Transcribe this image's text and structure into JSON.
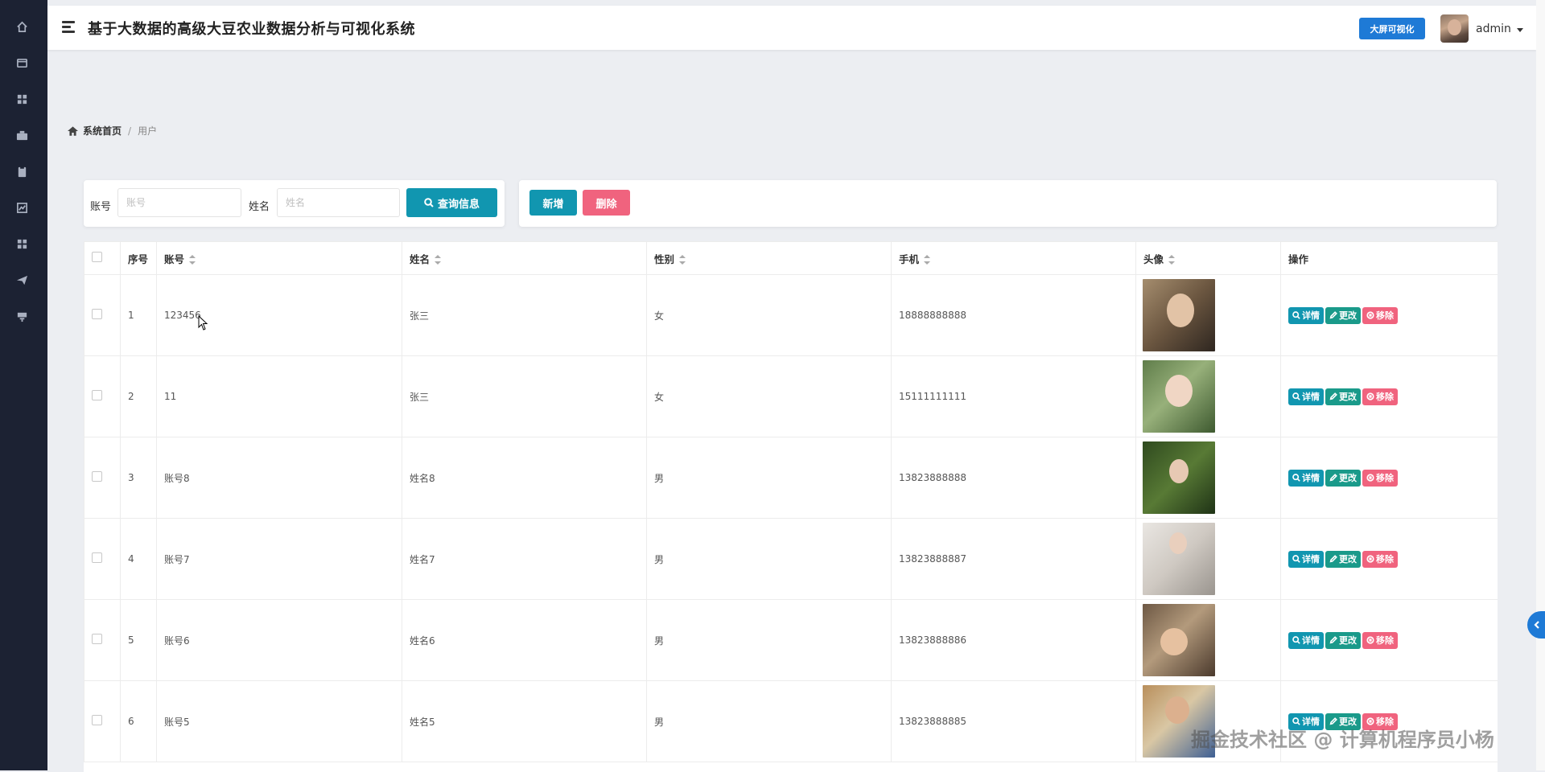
{
  "header": {
    "app_title": "基于大数据的高级大豆农业数据分析与可视化系统",
    "bigscreen_label": "大屏可视化",
    "username": "admin"
  },
  "sidebar": {
    "items": [
      {
        "icon": "home-icon"
      },
      {
        "icon": "card-icon"
      },
      {
        "icon": "grid-icon"
      },
      {
        "icon": "briefcase-icon"
      },
      {
        "icon": "clipboard-icon"
      },
      {
        "icon": "chart-icon"
      },
      {
        "icon": "apps-icon"
      },
      {
        "icon": "send-icon"
      },
      {
        "icon": "stamp-icon"
      }
    ]
  },
  "breadcrumb": {
    "home": "系统首页",
    "separator": "/",
    "current": "用户"
  },
  "search": {
    "account_label": "账号",
    "account_placeholder": "账号",
    "name_label": "姓名",
    "name_placeholder": "姓名",
    "query_label": "查询信息"
  },
  "actions": {
    "add_label": "新增",
    "delete_label": "删除"
  },
  "table": {
    "headers": {
      "index": "序号",
      "account": "账号",
      "name": "姓名",
      "gender": "性别",
      "phone": "手机",
      "avatar": "头像",
      "ops": "操作"
    },
    "rows": [
      {
        "index": "1",
        "account": "123456",
        "name": "张三",
        "gender": "女",
        "phone": "18888888888"
      },
      {
        "index": "2",
        "account": "11",
        "name": "张三",
        "gender": "女",
        "phone": "15111111111"
      },
      {
        "index": "3",
        "account": "账号8",
        "name": "姓名8",
        "gender": "男",
        "phone": "13823888888"
      },
      {
        "index": "4",
        "account": "账号7",
        "name": "姓名7",
        "gender": "男",
        "phone": "13823888887"
      },
      {
        "index": "5",
        "account": "账号6",
        "name": "姓名6",
        "gender": "男",
        "phone": "13823888886"
      },
      {
        "index": "6",
        "account": "账号5",
        "name": "姓名5",
        "gender": "男",
        "phone": "13823888885"
      }
    ],
    "op_labels": {
      "detail": "详情",
      "edit": "更改",
      "remove": "移除"
    }
  },
  "watermark": "掘金技术社区 @ 计算机程序员小杨",
  "colors": {
    "sidebar_bg": "#1c2233",
    "primary": "#1196b0",
    "edit": "#1a9a8a",
    "danger": "#f0637e",
    "accent_blue": "#1e7ad6"
  }
}
